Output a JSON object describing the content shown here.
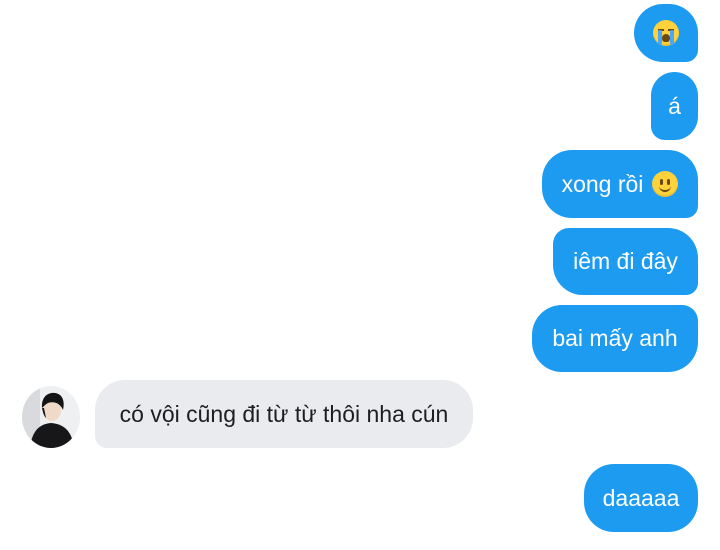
{
  "messages": [
    {
      "id": "m1",
      "direction": "outgoing",
      "text": "",
      "emoji": "loudly-crying-face"
    },
    {
      "id": "m2",
      "direction": "outgoing",
      "text": "á"
    },
    {
      "id": "m3",
      "direction": "outgoing",
      "text": "xong rồi",
      "emoji": "slightly-smiling-face"
    },
    {
      "id": "m4",
      "direction": "outgoing",
      "text": "iêm đi đây"
    },
    {
      "id": "m5",
      "direction": "outgoing",
      "text": "bai mấy anh"
    },
    {
      "id": "m6",
      "direction": "incoming",
      "text": "có vội cũng đi từ từ thôi nha cún",
      "avatar": "user-avatar"
    },
    {
      "id": "m7",
      "direction": "outgoing",
      "text": "daaaaa"
    }
  ],
  "colors": {
    "outgoing_bubble": "#1d9bf0",
    "incoming_bubble": "#e9ebef",
    "outgoing_text": "#ffffff",
    "incoming_text": "#1c1e21",
    "background": "#ffffff"
  }
}
